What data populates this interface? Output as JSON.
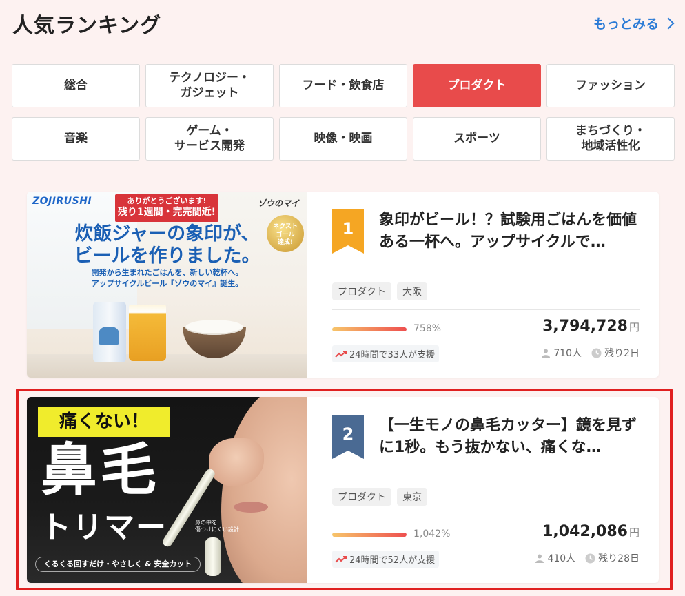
{
  "header": {
    "title": "人気ランキング",
    "more_label": "もっとみる"
  },
  "categories": [
    {
      "label": "総合",
      "active": false
    },
    {
      "label": "テクノロジー・\nガジェット",
      "active": false
    },
    {
      "label": "フード・飲食店",
      "active": false
    },
    {
      "label": "プロダクト",
      "active": true
    },
    {
      "label": "ファッション",
      "active": false
    },
    {
      "label": "音楽",
      "active": false
    },
    {
      "label": "ゲーム・\nサービス開発",
      "active": false
    },
    {
      "label": "映像・映画",
      "active": false
    },
    {
      "label": "スポーツ",
      "active": false
    },
    {
      "label": "まちづくり・\n地域活性化",
      "active": false
    }
  ],
  "projects": [
    {
      "rank": "1",
      "rank_color": "#f5a623",
      "title": "象印がビール！？試験用ごはんを価値ある一杯へ。アップサイクルで…",
      "tags": [
        "プロダクト",
        "大阪"
      ],
      "progress_percent": 100,
      "percent_label": "758%",
      "amount": "3,794,728",
      "currency": "円",
      "support_note": "24時間で33人が支援",
      "supporters": "710人",
      "remaining": "残り2日",
      "image": {
        "logo": "ZOJIRUSHI",
        "ribbon_top": "ありがとうございます!",
        "ribbon_main": "残り1週間・完売間近!",
        "corner_text": "ゾウのマイ",
        "medal_text": "ネクスト\nゴール\n達成!",
        "headline_1": "炊飯ジャーの象印が、",
        "headline_2": "ビールを作りました。",
        "subline_1": "開発から生まれたごはんを、新しい乾杯へ。",
        "subline_2": "アップサイクルビール『ゾウのマイ』誕生。"
      }
    },
    {
      "rank": "2",
      "rank_color": "#4a6a93",
      "title": "【一生モノの鼻毛カッター】鏡を見ずに1秒。もう抜かない、痛くな…",
      "tags": [
        "プロダクト",
        "東京"
      ],
      "progress_percent": 100,
      "percent_label": "1,042%",
      "amount": "1,042,086",
      "currency": "円",
      "support_note": "24時間で52人が支援",
      "supporters": "410人",
      "remaining": "残り28日",
      "image": {
        "banner": "痛くない！",
        "big_text": "鼻毛",
        "mid_text": "トリマー",
        "bottom_bar": "くるくる回すだけ・やさしく & 安全カット",
        "note": "鼻の中を\n傷つけにくい設計"
      }
    }
  ],
  "colors": {
    "accent_red": "#e84b4b",
    "link_blue": "#2b7bd6",
    "highlight_border": "#e02020",
    "background": "#fdf2f1"
  }
}
